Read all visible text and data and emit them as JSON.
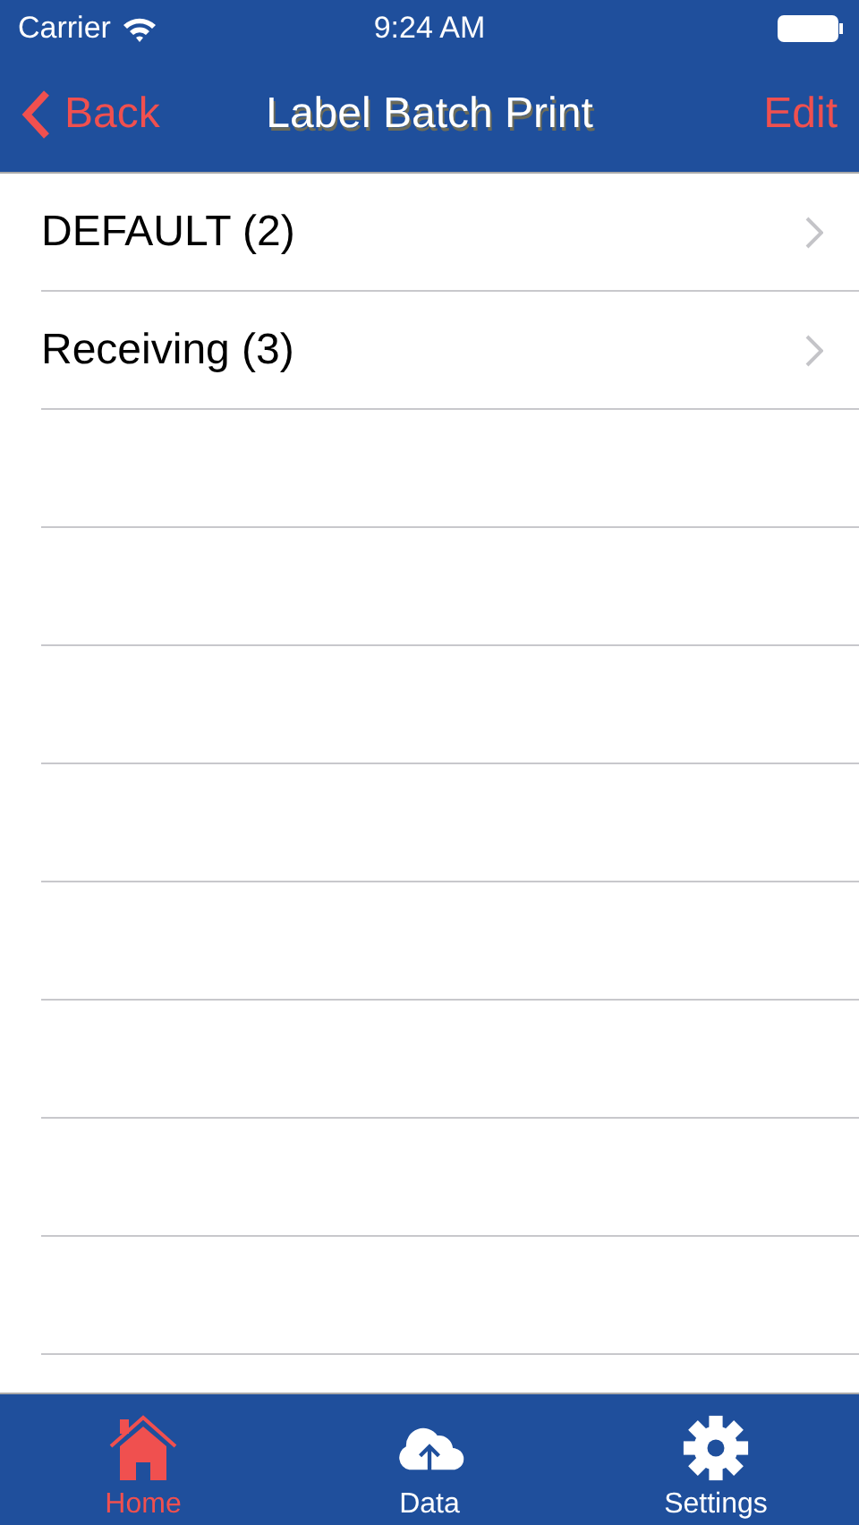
{
  "status_bar": {
    "carrier": "Carrier",
    "time": "9:24 AM"
  },
  "nav_bar": {
    "back": "Back",
    "title": "Label Batch Print",
    "action": "Edit"
  },
  "list": {
    "items": [
      {
        "label": "DEFAULT (2)"
      },
      {
        "label": "Receiving (3)"
      }
    ]
  },
  "tab_bar": {
    "tabs": [
      {
        "label": "Home",
        "kind": "home",
        "selected": true
      },
      {
        "label": "Data",
        "kind": "cloud",
        "selected": false
      },
      {
        "label": "Settings",
        "kind": "gear",
        "selected": false
      }
    ]
  }
}
